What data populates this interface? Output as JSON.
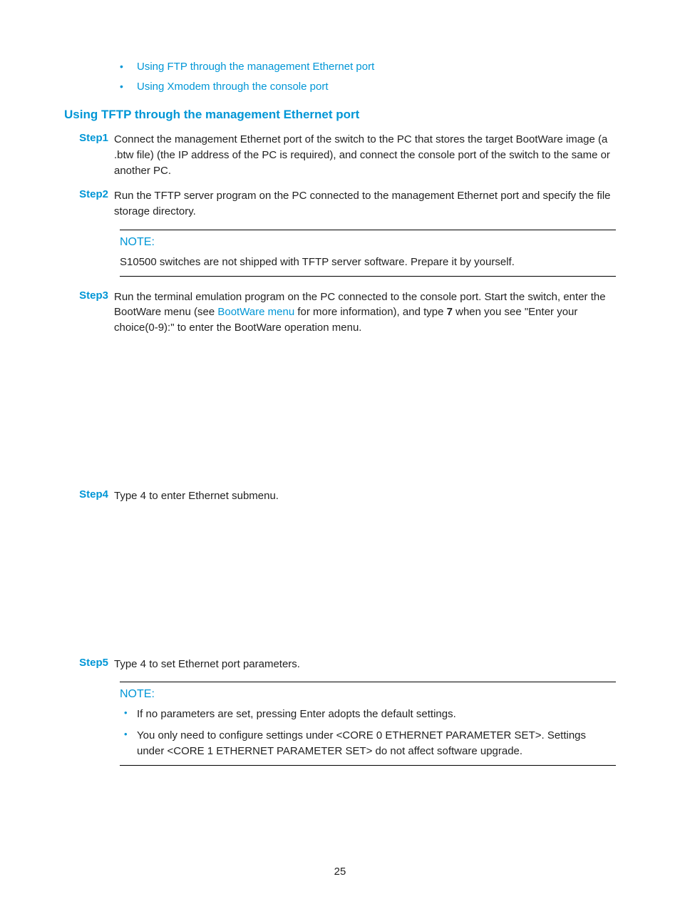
{
  "top_links": {
    "item0": "Using FTP through the management Ethernet port",
    "item1": "Using Xmodem through the console port"
  },
  "heading": "Using TFTP through the management Ethernet port",
  "steps": {
    "s1": {
      "label": "Step1",
      "text": "Connect the management Ethernet port of the switch to the PC that stores the target BootWare image (a .btw file) (the IP address of the PC is required), and connect the console port of the switch to the same or another PC."
    },
    "s2": {
      "label": "Step2",
      "text": "Run the TFTP server program on the PC connected to the management Ethernet port and specify the file storage directory."
    },
    "s3": {
      "label": "Step3",
      "pre": "Run the terminal emulation program on the PC connected to the console port. Start the switch, enter the BootWare menu (see ",
      "linktext": "BootWare menu",
      "mid": " for more information), and type ",
      "bold": "7",
      "post": " when you see \"Enter your choice(0-9):\" to enter the BootWare operation menu."
    },
    "s4": {
      "label": "Step4",
      "text": "Type 4 to enter Ethernet submenu."
    },
    "s5": {
      "label": "Step5",
      "text": "Type 4 to set Ethernet port parameters."
    }
  },
  "note1": {
    "label": "NOTE:",
    "text": "S10500 switches are not shipped with TFTP server software. Prepare it by yourself."
  },
  "note2": {
    "label": "NOTE:",
    "items": {
      "i0": "If no parameters are set, pressing Enter adopts the default settings.",
      "i1": "You only need to configure settings under <CORE 0 ETHERNET PARAMETER SET>. Settings under <CORE 1 ETHERNET PARAMETER SET> do not affect software upgrade."
    }
  },
  "page_number": "25"
}
